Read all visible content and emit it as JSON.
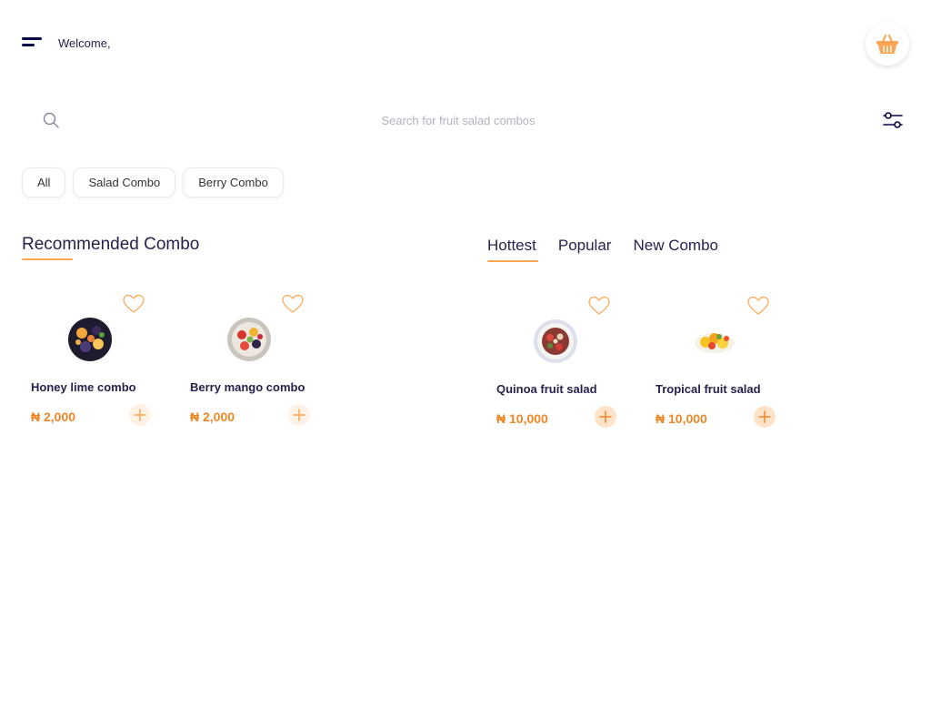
{
  "header": {
    "greeting": "Welcome,"
  },
  "search": {
    "placeholder": "Search for fruit salad combos",
    "value": ""
  },
  "chips": [
    {
      "label": "All"
    },
    {
      "label": "Salad Combo"
    },
    {
      "label": "Berry Combo"
    }
  ],
  "recommended": {
    "title": "Recommended Combo",
    "items": [
      {
        "name": "Honey lime combo",
        "price": "₦ 2,000"
      },
      {
        "name": "Berry mango combo",
        "price": "₦ 2,000"
      }
    ]
  },
  "tabs": [
    {
      "label": "Hottest",
      "active": true
    },
    {
      "label": "Popular",
      "active": false
    },
    {
      "label": "New Combo",
      "active": false
    }
  ],
  "hottest": {
    "items": [
      {
        "name": "Quinoa fruit salad",
        "price": "₦ 10,000"
      },
      {
        "name": "Tropical fruit salad",
        "price": "₦ 10,000"
      }
    ]
  },
  "colors": {
    "accent": "#FFA451",
    "price": "#F08626",
    "text": "#27214D",
    "placeholder": "#B3B2C1"
  },
  "icons": {
    "menu": "menu-icon",
    "basket": "basket-icon",
    "search": "search-icon",
    "filter": "filter-icon",
    "favorite": "heart-icon",
    "add": "plus-icon"
  }
}
